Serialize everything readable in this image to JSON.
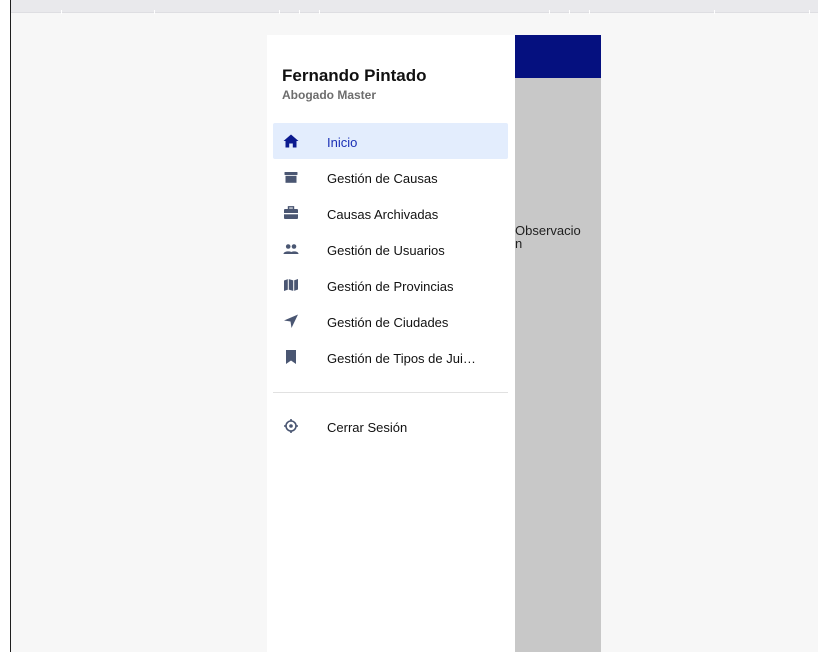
{
  "user": {
    "name": "Fernando Pintado",
    "role": "Abogado Master"
  },
  "menu": {
    "items": [
      {
        "label": "Inicio",
        "icon": "home-icon",
        "active": true
      },
      {
        "label": "Gestión de Causas",
        "icon": "box-icon"
      },
      {
        "label": "Causas Archivadas",
        "icon": "briefcase-icon"
      },
      {
        "label": "Gestión de Usuarios",
        "icon": "users-icon"
      },
      {
        "label": "Gestión de Provincias",
        "icon": "map-icon"
      },
      {
        "label": "Gestión de Ciudades",
        "icon": "location-arrow-icon"
      },
      {
        "label": "Gestión de Tipos de Jui…",
        "icon": "bookmark-icon"
      }
    ],
    "logout": {
      "label": "Cerrar Sesión",
      "icon": "logout-icon"
    }
  },
  "background": {
    "partial_text": "Observacio\nn"
  },
  "colors": {
    "header": "#05107f",
    "active_bg": "#e3edfd",
    "active_text": "#1a2fb5",
    "icon": "#4a5672"
  }
}
